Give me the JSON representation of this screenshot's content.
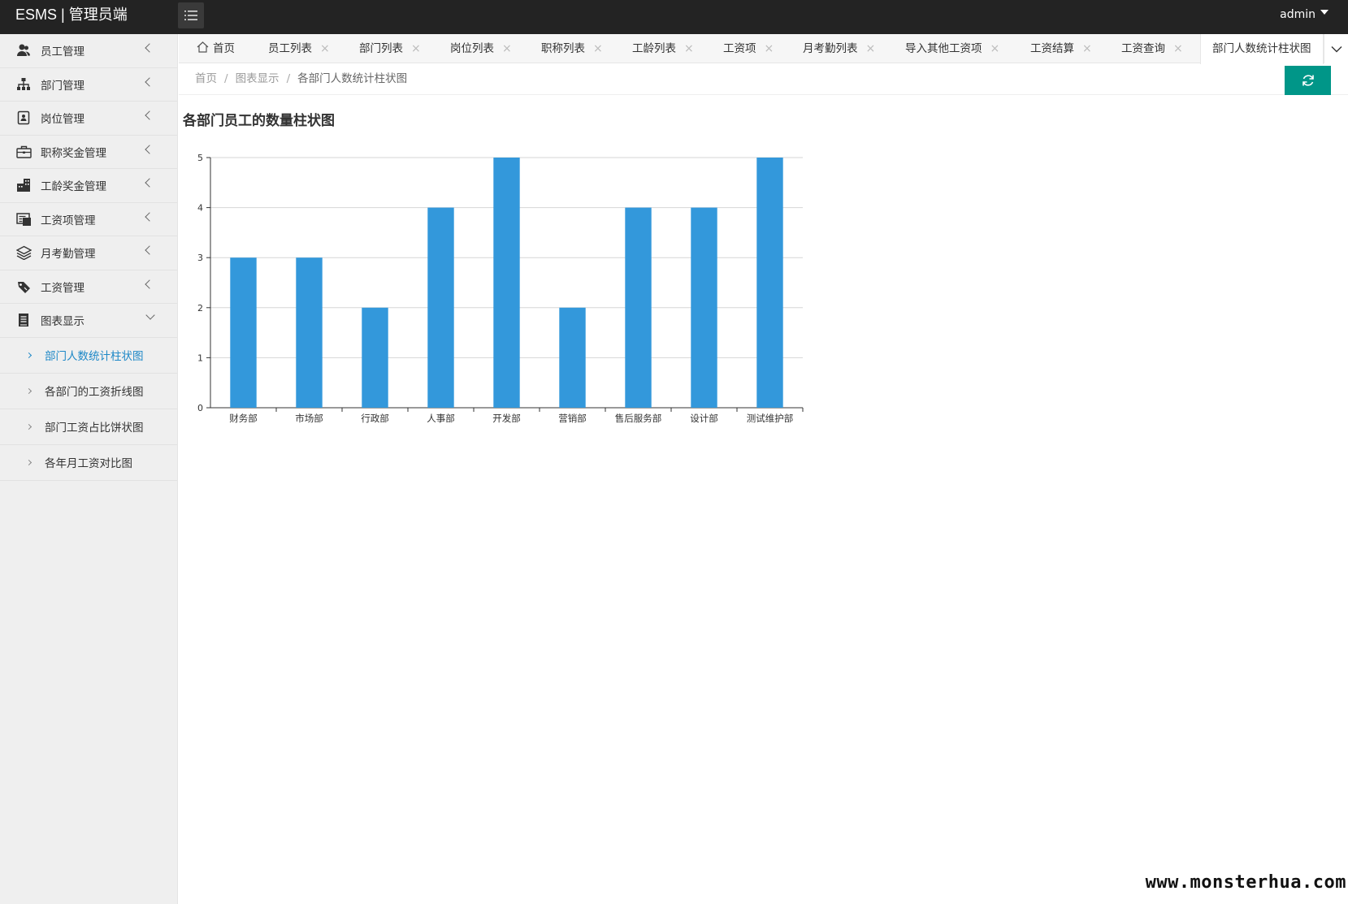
{
  "header": {
    "logo": "ESMS | 管理员端",
    "user": "admin"
  },
  "sidebar": {
    "items": [
      {
        "label": "员工管理",
        "icon": "users-icon"
      },
      {
        "label": "部门管理",
        "icon": "sitemap-icon"
      },
      {
        "label": "岗位管理",
        "icon": "id-badge-icon"
      },
      {
        "label": "职称奖金管理",
        "icon": "briefcase-icon"
      },
      {
        "label": "工龄奖金管理",
        "icon": "building-icon"
      },
      {
        "label": "工资项管理",
        "icon": "money-list-icon"
      },
      {
        "label": "月考勤管理",
        "icon": "layers-icon"
      },
      {
        "label": "工资管理",
        "icon": "tag-icon"
      },
      {
        "label": "图表显示",
        "icon": "chart-doc-icon"
      }
    ],
    "sub_items": [
      {
        "label": "部门人数统计柱状图",
        "active": true
      },
      {
        "label": "各部门的工资折线图",
        "active": false
      },
      {
        "label": "部门工资占比饼状图",
        "active": false
      },
      {
        "label": "各年月工资对比图",
        "active": false
      }
    ]
  },
  "tabs": {
    "home": "首页",
    "items": [
      {
        "label": "员工列表"
      },
      {
        "label": "部门列表"
      },
      {
        "label": "岗位列表"
      },
      {
        "label": "职称列表"
      },
      {
        "label": "工龄列表"
      },
      {
        "label": "工资项"
      },
      {
        "label": "月考勤列表"
      },
      {
        "label": "导入其他工资项"
      },
      {
        "label": "工资结算"
      },
      {
        "label": "工资查询"
      }
    ],
    "active": "部门人数统计柱状图"
  },
  "breadcrumb": {
    "home": "首页",
    "section": "图表显示",
    "current": "各部门人数统计柱状图",
    "separator": "/"
  },
  "page": {
    "title": "各部门员工的数量柱状图"
  },
  "chart_data": {
    "type": "bar",
    "categories": [
      "财务部",
      "市场部",
      "行政部",
      "人事部",
      "开发部",
      "营销部",
      "售后服务部",
      "设计部",
      "测试维护部"
    ],
    "values": [
      3,
      3,
      2,
      4,
      5,
      2,
      4,
      4,
      5
    ],
    "ylim": [
      0,
      5
    ],
    "yticks": [
      0,
      1,
      2,
      3,
      4,
      5
    ],
    "grid": true,
    "color": "#3398DB"
  },
  "watermark": "www.monsterhua.com"
}
